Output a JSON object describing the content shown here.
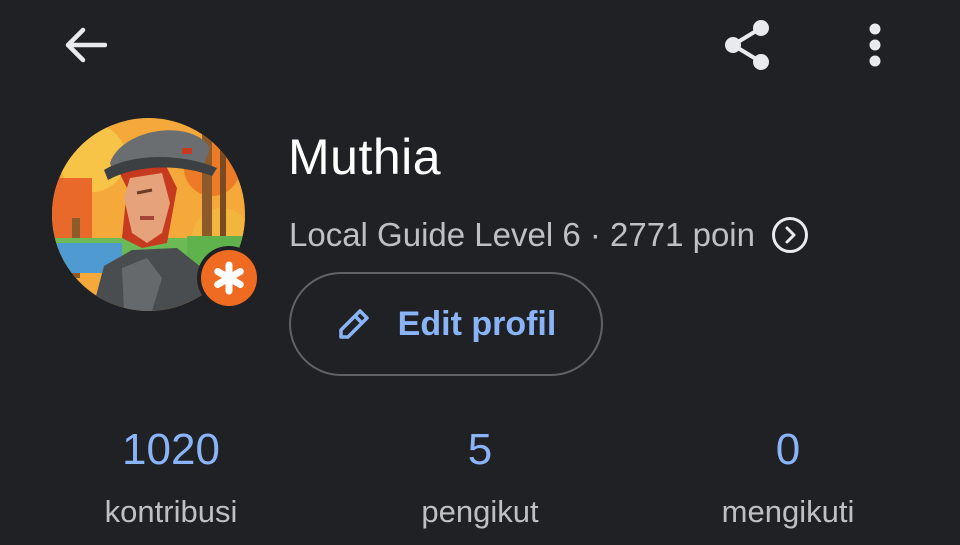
{
  "header": {
    "back_icon": "arrow-back-icon",
    "share_icon": "share-icon",
    "more_icon": "more-vert-icon"
  },
  "profile": {
    "name": "Muthia",
    "level_text": "Local Guide Level 6 · 2771 poin",
    "level_chevron_icon": "chevron-right-circle-icon",
    "badge_icon": "local-guide-star-icon",
    "badge_color": "#f06b22",
    "edit_button_label": "Edit profil",
    "edit_icon": "pencil-icon"
  },
  "stats": [
    {
      "value": "1020",
      "label": "kontribusi"
    },
    {
      "value": "5",
      "label": "pengikut"
    },
    {
      "value": "0",
      "label": "mengikuti"
    }
  ],
  "colors": {
    "background": "#202124",
    "accent": "#8ab4f8",
    "secondary_text": "#bdc1c6",
    "outline": "#5f6368"
  }
}
